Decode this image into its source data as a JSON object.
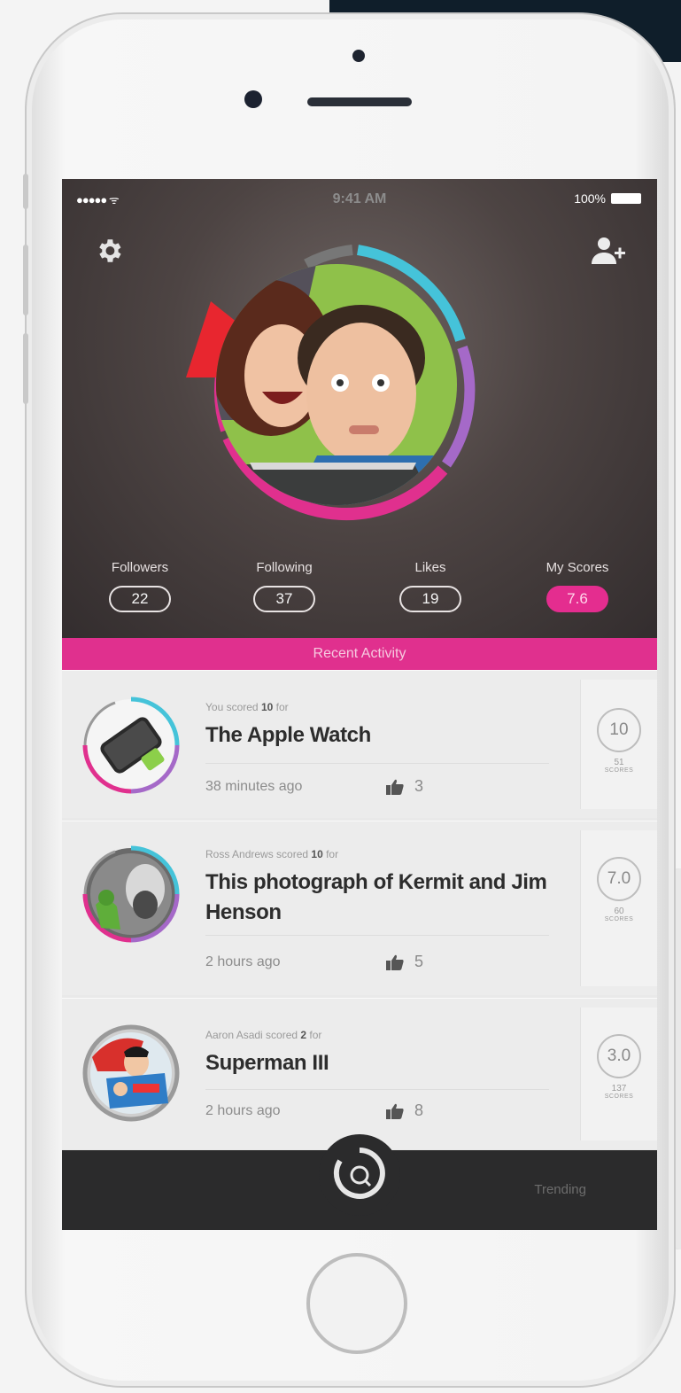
{
  "status_bar": {
    "signal": "●●●●● ᯤ",
    "time": "9:41 AM",
    "battery": "100%"
  },
  "profile": {
    "colors": {
      "ring_pink": "#e0308e",
      "ring_blue": "#45c3d9",
      "ring_purple": "#a569c8",
      "ring_red": "#e8262f",
      "accent": "#e0308e"
    }
  },
  "stats": [
    {
      "label": "Followers",
      "value": "22"
    },
    {
      "label": "Following",
      "value": "37"
    },
    {
      "label": "Likes",
      "value": "19"
    },
    {
      "label": "My Scores",
      "value": "7.6"
    }
  ],
  "recent_activity_label": "Recent Activity",
  "activity": [
    {
      "meta_prefix": "You scored ",
      "meta_score": "10",
      "meta_suffix": " for",
      "title": "The Apple Watch",
      "time": "38 minutes ago",
      "likes": "3",
      "score": "10",
      "score_count": "51",
      "score_label": "SCORES"
    },
    {
      "meta_prefix": "Ross Andrews scored ",
      "meta_score": "10",
      "meta_suffix": " for",
      "title": "This photograph of Kermit and Jim Henson",
      "time": "2 hours ago",
      "likes": "5",
      "score": "7.0",
      "score_count": "60",
      "score_label": "SCORES"
    },
    {
      "meta_prefix": "Aaron Asadi scored ",
      "meta_score": "2",
      "meta_suffix": " for",
      "title": "Superman III",
      "time": "2 hours ago",
      "likes": "8",
      "score": "3.0",
      "score_count": "137",
      "score_label": "SCORES"
    }
  ],
  "tab_bar": {
    "trending_label": "Trending"
  },
  "icons": {
    "settings": "gear-icon",
    "add_user": "add-user-icon",
    "like": "thumbs-up-icon",
    "center": "scan-icon"
  }
}
